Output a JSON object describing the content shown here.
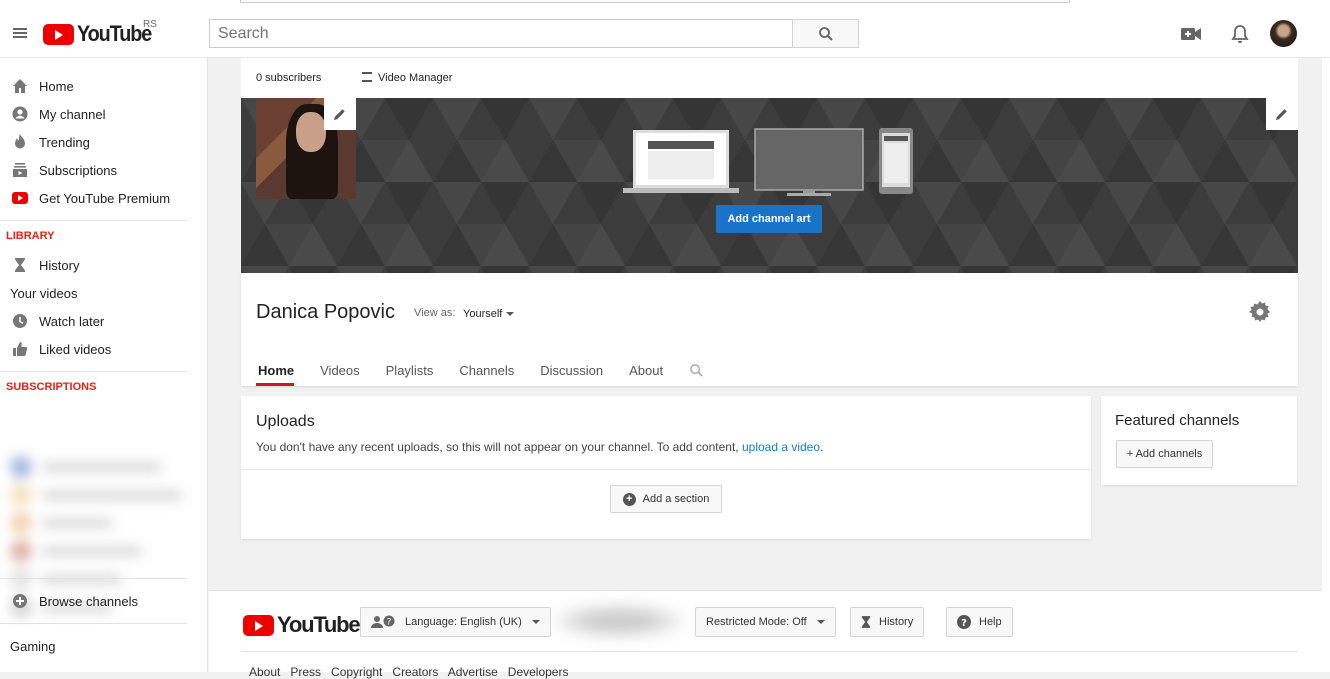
{
  "masthead": {
    "logo_text": "YouTube",
    "region": "RS",
    "search_placeholder": "Search",
    "icons": [
      "menu-icon",
      "search-icon",
      "upload-video-icon",
      "notifications-bell-icon"
    ]
  },
  "sidebar": {
    "main_items": [
      {
        "label": "Home",
        "icon": "home-icon"
      },
      {
        "label": "My channel",
        "icon": "account-icon"
      },
      {
        "label": "Trending",
        "icon": "flame-icon"
      },
      {
        "label": "Subscriptions",
        "icon": "subscriptions-icon"
      },
      {
        "label": "Get YouTube Premium",
        "icon": "youtube-premium-icon"
      }
    ],
    "library_heading": "LIBRARY",
    "library_items": [
      {
        "label": "History",
        "icon": "hourglass-icon"
      },
      {
        "label": "Your videos",
        "icon": ""
      },
      {
        "label": "Watch later",
        "icon": "clock-icon"
      },
      {
        "label": "Liked videos",
        "icon": "thumbs-up-icon"
      }
    ],
    "subscriptions_heading": "SUBSCRIPTIONS",
    "browse_channels": "Browse channels",
    "gaming": "Gaming"
  },
  "channel": {
    "subscribers": "0 subscribers",
    "video_manager": "Video Manager",
    "add_channel_art": "Add channel art",
    "name": "Danica Popovic",
    "view_as_label": "View as:",
    "view_as_value": "Yourself",
    "tabs": [
      "Home",
      "Videos",
      "Playlists",
      "Channels",
      "Discussion",
      "About"
    ],
    "active_tab": "Home"
  },
  "uploads": {
    "title": "Uploads",
    "message": "You don't have any recent uploads, so this will not appear on your channel. To add content, ",
    "link": "upload a video",
    "message_end": ".",
    "add_section": "Add a section"
  },
  "featured": {
    "title": "Featured channels",
    "add_channels": "+ Add channels"
  },
  "footer": {
    "logo_text": "YouTube",
    "language": "Language: English (UK)",
    "restricted": "Restricted Mode: Off",
    "history": "History",
    "help": "Help",
    "links": "About   Press   Copyright   Creators   Advertise   Developers"
  },
  "colors": {
    "brand_red": "#e00",
    "accent_blue": "#1b73c8",
    "link": "#167ac6",
    "library_red": "#e62117"
  }
}
